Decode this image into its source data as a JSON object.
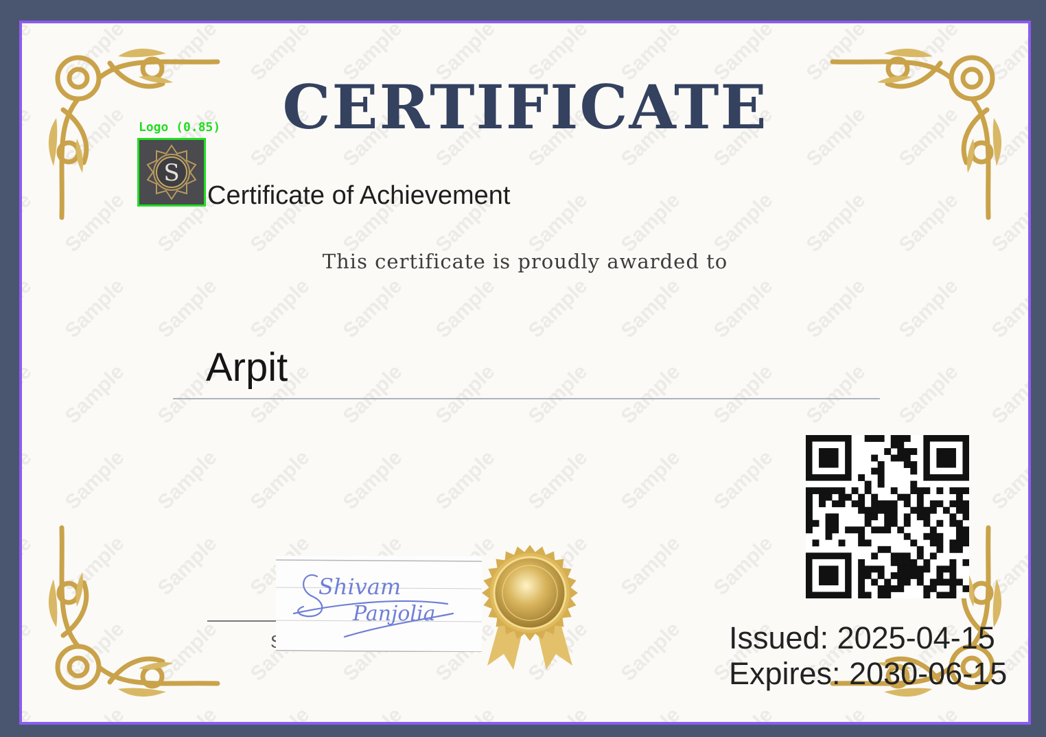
{
  "certificate": {
    "title": "CERTIFICATE",
    "subtitle": "Certificate of Achievement",
    "awarded_text": "This certificate is proudly awarded to",
    "recipient_name": "Arpit",
    "issued_label": "Issued: ",
    "issued_date": "2025-04-15",
    "expires_label": "Expires: ",
    "expires_date": "2030-06-15",
    "signature_partial": "S",
    "watermark_text": "Sample",
    "logo_letter": "S"
  },
  "signature": {
    "first_name": "Shivam",
    "last_name": "Panjolia"
  },
  "detection": {
    "label": "Logo (0.85)",
    "class": "Logo",
    "confidence": 0.85
  },
  "colors": {
    "frame_border": "#8d5cf0",
    "outer_background": "#4a5670",
    "title": "#34415f",
    "gold": "#c9a24a",
    "detection_box": "#22dd22",
    "signature_ink": "#6f7fd6"
  }
}
